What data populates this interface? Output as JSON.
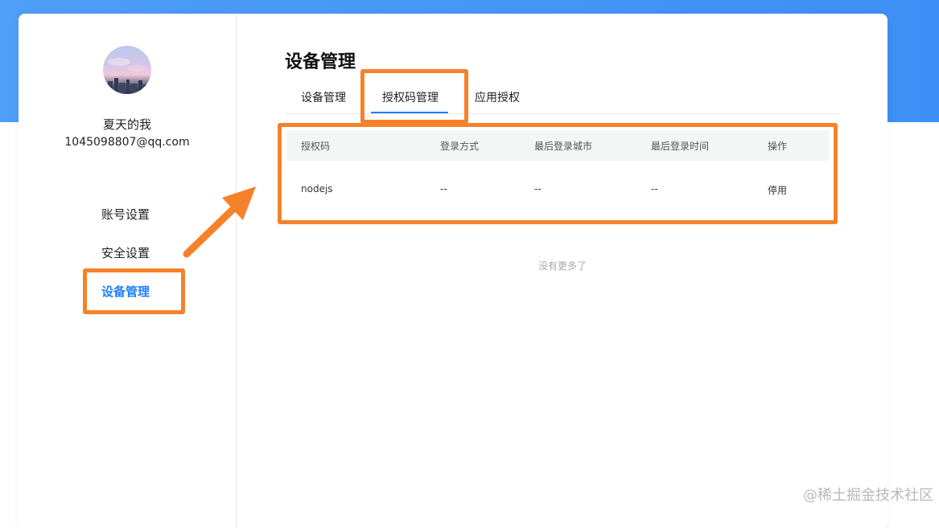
{
  "colors": {
    "accent": "#1e80ff",
    "annotation": "#f5822a",
    "header_bg": "#4f9ef7"
  },
  "user": {
    "avatar_icon": "avatar-photo",
    "name": "夏天的我",
    "email": "1045098807@qq.com"
  },
  "sidebar": {
    "items": [
      {
        "label": "账号设置",
        "active": false
      },
      {
        "label": "安全设置",
        "active": false
      },
      {
        "label": "设备管理",
        "active": true
      }
    ]
  },
  "main": {
    "title": "设备管理",
    "tabs": [
      {
        "label": "设备管理",
        "active": false
      },
      {
        "label": "授权码管理",
        "active": true
      },
      {
        "label": "应用授权",
        "active": false
      }
    ],
    "table": {
      "headers": [
        "授权码",
        "登录方式",
        "最后登录城市",
        "最后登录时间",
        "操作"
      ],
      "rows": [
        [
          "nodejs",
          "--",
          "--",
          "--",
          "停用"
        ]
      ]
    },
    "empty_text": "没有更多了"
  },
  "watermark": "@稀土掘金技术社区"
}
